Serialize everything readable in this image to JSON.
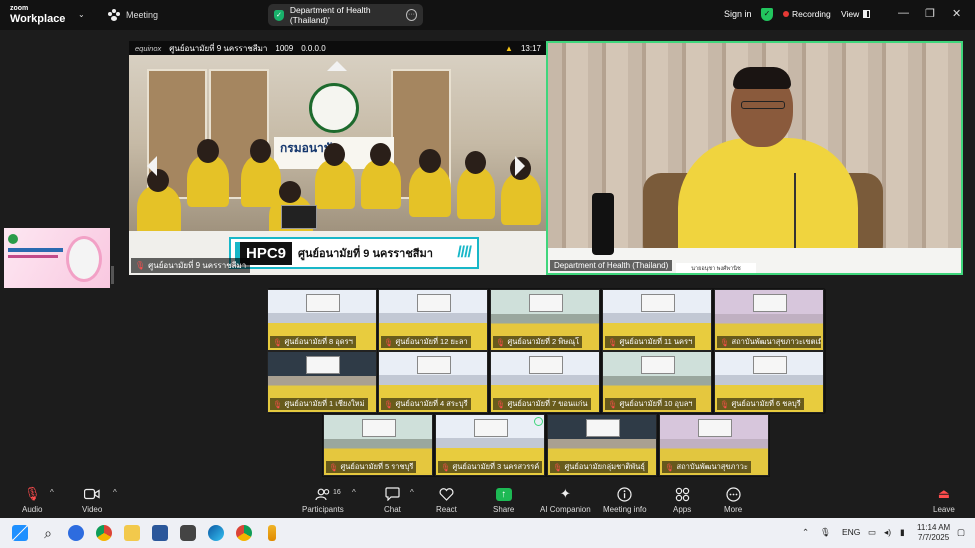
{
  "titlebar": {
    "brand_top": "zoom",
    "brand_bottom": "Workplace",
    "meeting_label": "Meeting",
    "tab_title": "Department of Health (Thailand)'",
    "sign_in": "Sign in",
    "recording": "Recording",
    "view": "View",
    "win_minimize": "—",
    "win_restore": "❐",
    "win_close": "✕"
  },
  "left_tile": {
    "osd_brand": "equinox",
    "osd_title": "ศูนย์อนามัยที่ 9 นครราชสีมา",
    "osd_code": "1009",
    "osd_ip": "0.0.0.0",
    "osd_time": "13:17",
    "sign_text": "กรมอนามัย",
    "banner_code": "HPC9",
    "banner_text": "ศูนย์อนามัยที่ 9 นครราชสีมา",
    "banner_stripes": "////",
    "name": "ศูนย์อนามัยที่ 9 นครราชสีมา"
  },
  "right_tile": {
    "nameplate": "นายอนุชา พงศ์พานิช",
    "name": "Department of Health (Thailand)"
  },
  "gallery": [
    {
      "label": "ศูนย์อนามัยที่ 8 อุดรฯ",
      "style": "blue"
    },
    {
      "label": "ศูนย์อนามัยที่ 12 ยะลา",
      "style": "blue"
    },
    {
      "label": "ศูนย์อนามัยที่ 2 พิษณุโ",
      "style": "teal"
    },
    {
      "label": "ศูนย์อนามัยที่ 11 นครฯ",
      "style": "blue"
    },
    {
      "label": "สถาบันพัฒนาสุขภาวะเขตเมือง",
      "style": "pink"
    },
    {
      "label": "ศูนย์อนามัยที่ 1 เชียงใหม่",
      "style": "dark"
    },
    {
      "label": "ศูนย์อนามัยที่ 4 สระบุรี",
      "style": "blue"
    },
    {
      "label": "ศูนย์อนามัยที่ 7 ขอนแก่น",
      "style": "blue"
    },
    {
      "label": "ศูนย์อนามัยที่ 10 อุบลฯ",
      "style": "teal"
    },
    {
      "label": "ศูนย์อนามัยที่ 6 ชลบุรี",
      "style": "blue"
    },
    {
      "label": "ศูนย์อนามัยที่ 5 ราชบุรี",
      "style": "teal"
    },
    {
      "label": "ศูนย์อนามัยที่ 3 นครสวรรค์",
      "style": "blue"
    },
    {
      "label": "ศูนย์อนามัยกลุ่มชาติพันธุ์",
      "style": "dark"
    },
    {
      "label": "สถาบันพัฒนาสุขภาวะ",
      "style": "pink"
    }
  ],
  "controls": {
    "audio": "Audio",
    "video": "Video",
    "participants": "Participants",
    "participants_count": "16",
    "chat": "Chat",
    "react": "React",
    "share": "Share",
    "ai_companion": "AI Companion",
    "meeting_info": "Meeting info",
    "apps": "Apps",
    "more": "More",
    "leave": "Leave"
  },
  "taskbar": {
    "lang": "ENG",
    "time": "11:14 AM",
    "date": "7/7/2025"
  },
  "colors": {
    "active_speaker": "#3fd67c",
    "recording": "#e53935",
    "share": "#1db954",
    "muted": "#ff4d4d"
  }
}
